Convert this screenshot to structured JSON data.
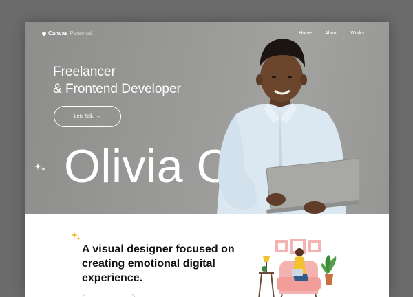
{
  "brand": {
    "name": "Canvas",
    "suffix": "Personal."
  },
  "nav": [
    {
      "label": "Home"
    },
    {
      "label": "About"
    },
    {
      "label": "Works"
    }
  ],
  "hero": {
    "line1": "Freelancer",
    "line2": "& Frontend Developer",
    "cta_label": "Lets Talk",
    "cta_arrow": "→",
    "big_name": "Olivia Corliss"
  },
  "about": {
    "line1": "A visual designer focused on",
    "line2": "creating emotional digital",
    "line3": "experience."
  },
  "colors": {
    "hero_bg": "#9a9a98",
    "accent_sparkle": "#f2b51d",
    "illustration_pink": "#f4b3b0",
    "illustration_yellow": "#f2c230",
    "illustration_green": "#3f8a3a"
  },
  "icons": [
    "logo-dot-icon",
    "arrow-right-icon",
    "sparkle-icon"
  ]
}
